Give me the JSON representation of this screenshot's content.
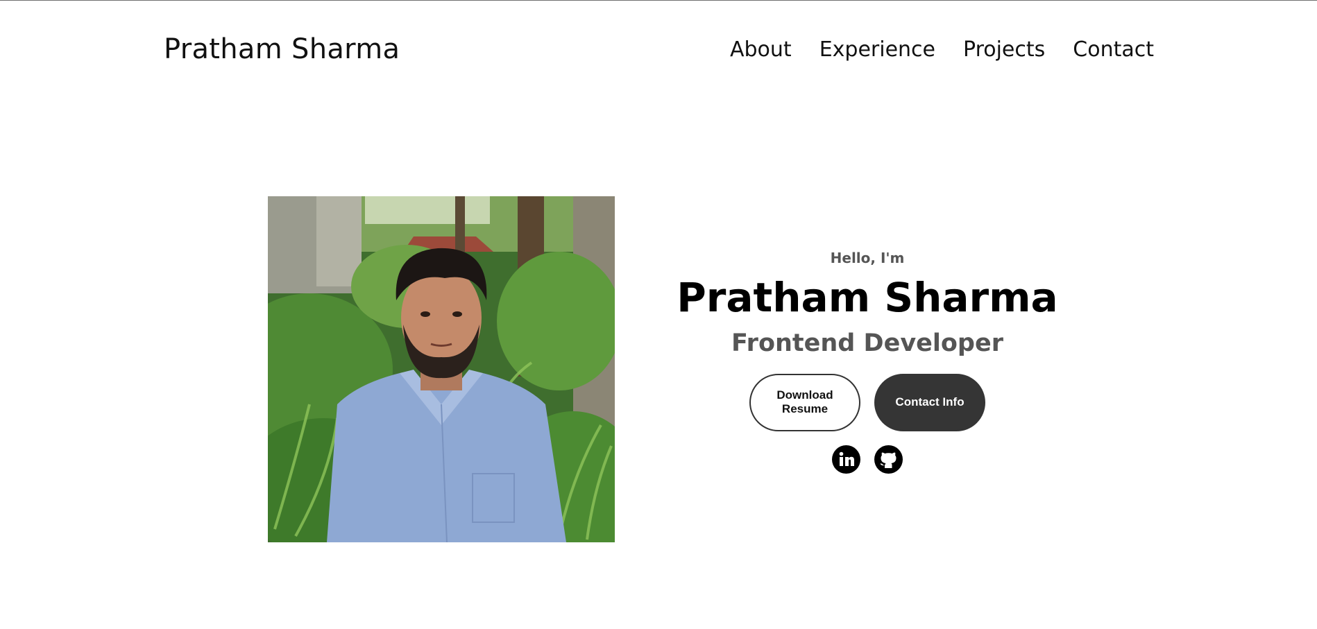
{
  "header": {
    "logo": "Pratham Sharma",
    "nav": [
      "About",
      "Experience",
      "Projects",
      "Contact"
    ]
  },
  "hero": {
    "greeting": "Hello, I'm",
    "name": "Pratham Sharma",
    "role": "Frontend Developer",
    "buttons": {
      "resume": "Download Resume",
      "contact": "Contact Info"
    },
    "socials": [
      "linkedin-icon",
      "github-icon"
    ]
  },
  "colors": {
    "button_dark": "#353535",
    "subtitle": "#555555"
  }
}
